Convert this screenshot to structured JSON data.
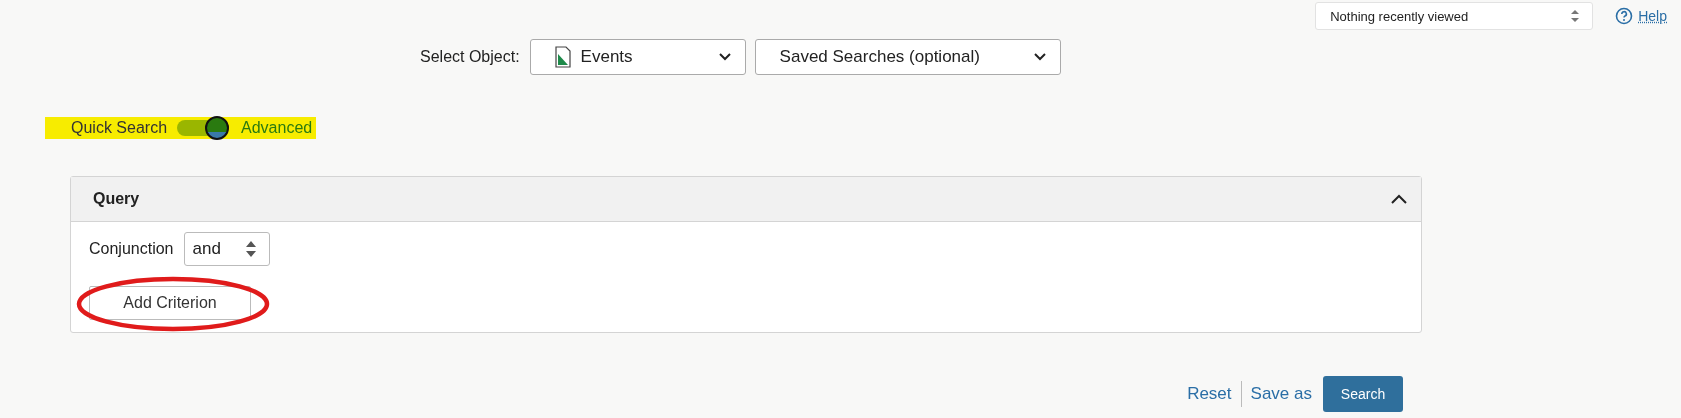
{
  "recent": {
    "value": "Nothing recently viewed"
  },
  "help": {
    "label": "Help"
  },
  "object_select": {
    "label": "Select Object:",
    "value": "Events"
  },
  "saved_searches": {
    "value": "Saved Searches (optional)"
  },
  "mode_toggle": {
    "left_label": "Quick Search",
    "right_label": "Advanced",
    "on": true,
    "highlighted": true
  },
  "query": {
    "title": "Query",
    "expanded": true,
    "conjunction_label": "Conjunction",
    "conjunction_value": "and",
    "add_button": "Add Criterion",
    "add_button_circled": true
  },
  "actions": [
    {
      "label": "Reset",
      "kind": "link"
    },
    {
      "label": "Save as",
      "kind": "link"
    },
    {
      "label": "Search",
      "kind": "button"
    }
  ]
}
